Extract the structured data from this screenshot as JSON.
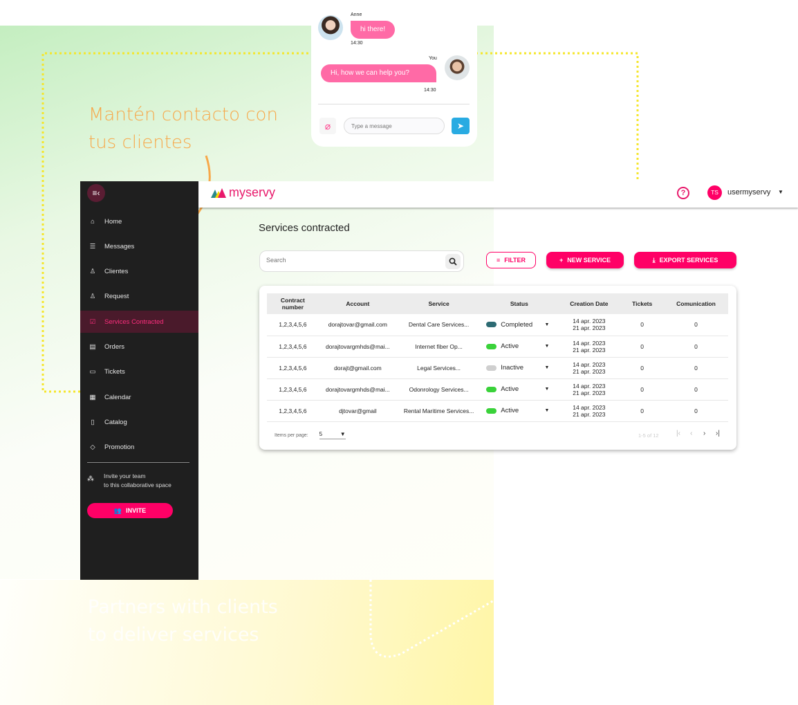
{
  "marketing": {
    "headline": "Mantén contacto con tus clientes",
    "tagline": "Partners with clients to deliver services",
    "dotted_color": "#f5e62a",
    "arrow_color": "#f7a84a"
  },
  "chat": {
    "messages": [
      {
        "sender": "Anne",
        "text": "hi there!",
        "time": "14:30"
      },
      {
        "sender": "You",
        "text": "Hi, how we can help you?",
        "time": "14:30"
      }
    ],
    "input_placeholder": "Type a message",
    "bubble_color": "#ff6aa6",
    "send_color": "#29abe2"
  },
  "sidebar": {
    "items": [
      {
        "label": "Home",
        "icon": "home-icon"
      },
      {
        "label": "Messages",
        "icon": "message-icon"
      },
      {
        "label": "Clientes",
        "icon": "person-icon"
      },
      {
        "label": "Request",
        "icon": "person-icon"
      },
      {
        "label": "Services Contracted",
        "icon": "checkbox-icon",
        "active": true
      },
      {
        "label": "Orders",
        "icon": "orders-icon"
      },
      {
        "label": "Tickets",
        "icon": "folder-icon"
      },
      {
        "label": "Calendar",
        "icon": "calendar-icon"
      },
      {
        "label": "Catalog",
        "icon": "book-icon"
      },
      {
        "label": "Promotion",
        "icon": "tag-icon"
      }
    ],
    "invite_line1": "Invite your team",
    "invite_line2": "to this collaborative space",
    "invite_button": "INVITE"
  },
  "header": {
    "brand": "myservy",
    "user_initials": "TS",
    "user_name": "usermyservy",
    "accent": "#ff0066"
  },
  "main": {
    "title": "Services contracted",
    "search_placeholder": "Search",
    "filter_label": "FILTER",
    "new_service_label": "NEW SERVICE",
    "export_label": "EXPORT SERVICES",
    "table": {
      "headers": [
        "Contract number",
        "Account",
        "Service",
        "Status",
        "Creation Date",
        "Tickets",
        "Comunication"
      ],
      "rows": [
        {
          "contract": "1,2,3,4,5,6",
          "account": "dorajtovar@gmail.com",
          "service": "Dental Care Services...",
          "status": "Completed",
          "status_color": "#2d6b73",
          "date1": "14 apr. 2023",
          "date2": "21 apr. 2023",
          "tickets": "0",
          "comunication": "0"
        },
        {
          "contract": "1,2,3,4,5,6",
          "account": "dorajtovargmhds@mai...",
          "service": "Internet fiber Op...",
          "status": "Active",
          "status_color": "#3ad23a",
          "date1": "14 apr. 2023",
          "date2": "21 apr. 2023",
          "tickets": "0",
          "comunication": "0"
        },
        {
          "contract": "1,2,3,4,5,6",
          "account": "dorajt@gmail.com",
          "service": "Legal Services...",
          "status": "Inactive",
          "status_color": "#cfcfcf",
          "date1": "14 apr. 2023",
          "date2": "21 apr. 2023",
          "tickets": "0",
          "comunication": "0"
        },
        {
          "contract": "1,2,3,4,5,6",
          "account": "dorajtovargmhds@mai...",
          "service": "Odonrology Services...",
          "status": "Active",
          "status_color": "#3ad23a",
          "date1": "14 apr. 2023",
          "date2": "21 apr. 2023",
          "tickets": "0",
          "comunication": "0"
        },
        {
          "contract": "1,2,3,4,5,6",
          "account": "djtovar@gmail",
          "service": "Rental Maritime Services...",
          "status": "Active",
          "status_color": "#3ad23a",
          "date1": "14 apr. 2023",
          "date2": "21 apr. 2023",
          "tickets": "0",
          "comunication": "0"
        }
      ]
    },
    "paginator": {
      "items_per_page_label": "Items per page:",
      "page_size": "5",
      "range": "1-5 of 12"
    }
  }
}
